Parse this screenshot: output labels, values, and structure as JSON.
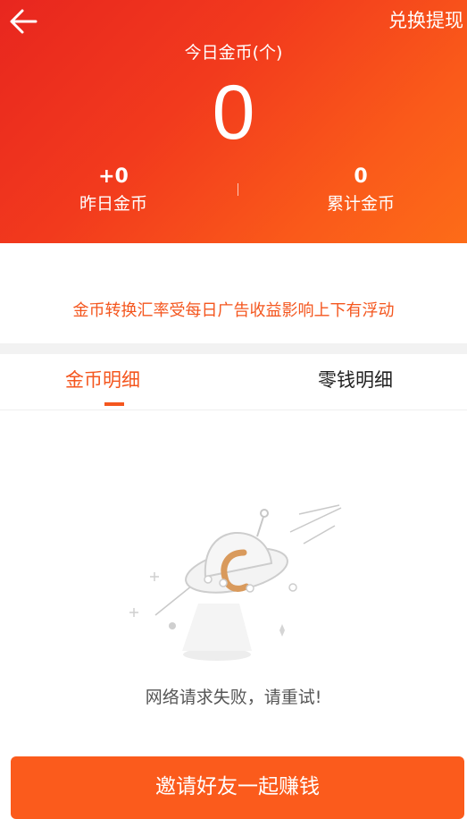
{
  "header": {
    "back_icon": "arrow-left-icon",
    "exchange_label": "兑换提现",
    "today_title": "今日金币(个)",
    "today_value": "0",
    "yesterday": {
      "value": "+0",
      "label": "昨日金币"
    },
    "total": {
      "value": "0",
      "label": "累计金币"
    }
  },
  "notice": "金币转换汇率受每日广告收益影响上下有浮动",
  "tabs": [
    {
      "label": "金币明细",
      "active": true
    },
    {
      "label": "零钱明细",
      "active": false
    }
  ],
  "empty_state": {
    "icon": "ufo-icon",
    "message": "网络请求失败，请重试!"
  },
  "invite_button": "邀请好友一起赚钱",
  "colors": {
    "accent": "#f4561e",
    "header_start": "#e8261f",
    "header_end": "#fd6c18",
    "button": "#fb5b1c"
  }
}
